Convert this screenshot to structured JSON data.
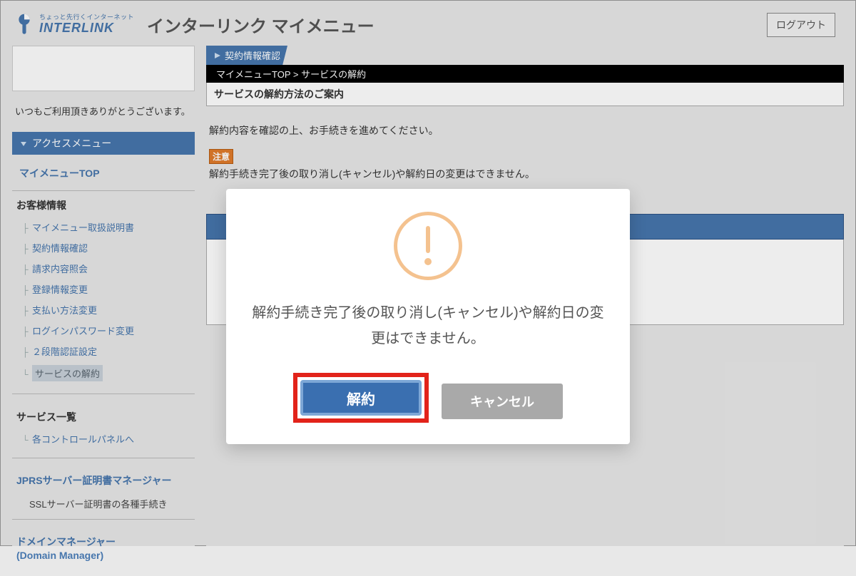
{
  "header": {
    "logo_tag": "ちょっと先行くインターネット",
    "logo_brand": "INTERLINK",
    "title": "インターリンク マイメニュー",
    "logout_label": "ログアウト"
  },
  "sidebar": {
    "thanks": "いつもご利用頂きありがとうございます。",
    "menu_head": "アクセスメニュー",
    "top_link": "マイメニューTOP",
    "sections": {
      "customer_title": "お客様情報",
      "customer_items": [
        "マイメニュー取扱説明書",
        "契約情報確認",
        "請求内容照会",
        "登録情報変更",
        "支払い方法変更",
        "ログインパスワード変更",
        "２段階認証設定"
      ],
      "customer_current": "サービスの解約",
      "services_title": "サービス一覧",
      "services_item": "各コントロールパネルへ",
      "jprs_title": "JPRSサーバー証明書マネージャー",
      "jprs_item": "SSLサーバー証明書の各種手続き",
      "domain_title": "ドメインマネージャー",
      "domain_sub": "(Domain Manager)"
    }
  },
  "main": {
    "tab_label": "契約情報確認",
    "breadcrumb": "マイメニューTOP  >  サービスの解約",
    "sub_caption": "サービスの解約方法のご案内",
    "body_copy": "解約内容を確認の上、お手続きを進めてください。",
    "notice_label": "注意",
    "notice_text": "解約手続き完了後の取り消し(キャンセル)や解約日の変更はできません。"
  },
  "modal": {
    "message": "解約手続き完了後の取り消し(キャンセル)や解約日の変更はできません。",
    "confirm_label": "解約",
    "cancel_label": "キャンセル"
  }
}
